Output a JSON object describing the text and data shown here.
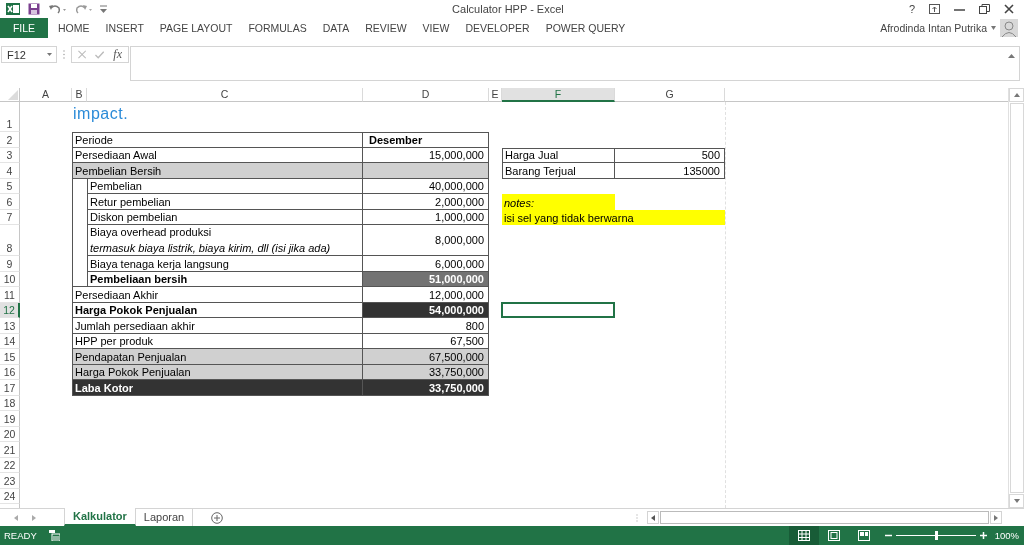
{
  "window": {
    "title": "Calculator HPP - Excel",
    "help": "?"
  },
  "ribbon": {
    "file_tab": "FILE",
    "tabs": [
      "HOME",
      "INSERT",
      "PAGE LAYOUT",
      "FORMULAS",
      "DATA",
      "REVIEW",
      "VIEW",
      "DEVELOPER",
      "POWER QUERY"
    ],
    "user": "Afrodinda Intan Putrika"
  },
  "formula_bar": {
    "name_box": "F12",
    "function_label": "fx"
  },
  "sheet": {
    "columns": [
      {
        "label": "A",
        "selected": false
      },
      {
        "label": "B",
        "selected": false
      },
      {
        "label": "C",
        "selected": false
      },
      {
        "label": "D",
        "selected": false
      },
      {
        "label": "E",
        "selected": false
      },
      {
        "label": "F",
        "selected": true
      },
      {
        "label": "G",
        "selected": false
      }
    ],
    "rows": [
      {
        "label": "1",
        "selected": false
      },
      {
        "label": "2",
        "selected": false
      },
      {
        "label": "3",
        "selected": false
      },
      {
        "label": "4",
        "selected": false
      },
      {
        "label": "5",
        "selected": false
      },
      {
        "label": "6",
        "selected": false
      },
      {
        "label": "7",
        "selected": false
      },
      {
        "label": "8",
        "selected": false
      },
      {
        "label": "9",
        "selected": false
      },
      {
        "label": "10",
        "selected": false
      },
      {
        "label": "11",
        "selected": false
      },
      {
        "label": "12",
        "selected": true
      },
      {
        "label": "13",
        "selected": false
      },
      {
        "label": "14",
        "selected": false
      },
      {
        "label": "15",
        "selected": false
      },
      {
        "label": "16",
        "selected": false
      },
      {
        "label": "17",
        "selected": false
      },
      {
        "label": "18",
        "selected": false
      },
      {
        "label": "19",
        "selected": false
      },
      {
        "label": "20",
        "selected": false
      },
      {
        "label": "21",
        "selected": false
      },
      {
        "label": "22",
        "selected": false
      },
      {
        "label": "23",
        "selected": false
      },
      {
        "label": "24",
        "selected": false
      }
    ],
    "logo": "impact.",
    "main_table": [
      {
        "kind": "heading",
        "indent": false,
        "label": "Periode",
        "value": "Desember"
      },
      {
        "kind": "plain",
        "indent": false,
        "label": "Persediaan Awal",
        "value": "15,000,000"
      },
      {
        "kind": "shaded",
        "indent": false,
        "label": "Pembelian Bersih"
      },
      {
        "kind": "plain",
        "indent": true,
        "label": "Pembelian",
        "value": "40,000,000"
      },
      {
        "kind": "plain",
        "indent": true,
        "label": "Retur pembelian",
        "value": "2,000,000"
      },
      {
        "kind": "plain",
        "indent": true,
        "label": "Diskon pembelian",
        "value": "1,000,000"
      },
      {
        "kind": "plain",
        "indent": true,
        "label": "Biaya overhead produksi",
        "note": "termasuk biaya listrik, biaya kirim, dll (isi jika ada)",
        "value": "8,000,000"
      },
      {
        "kind": "plain",
        "indent": true,
        "label": "Biaya tenaga kerja langsung",
        "value": "6,000,000"
      },
      {
        "kind": "subtotal",
        "indent": true,
        "label": "Pembeliaan bersih",
        "value": "51,000,000"
      },
      {
        "kind": "plain",
        "indent": false,
        "label": "Persediaan Akhir",
        "value": "12,000,000"
      },
      {
        "kind": "total",
        "indent": false,
        "label": "Harga Pokok Penjualan",
        "value": "54,000,000"
      },
      {
        "kind": "plain",
        "indent": false,
        "label": "Jumlah persediaan akhir",
        "value": "800"
      },
      {
        "kind": "plain",
        "indent": false,
        "label": "HPP per produk",
        "value": "67,500"
      },
      {
        "kind": "shaded",
        "indent": false,
        "label": "Pendapatan Penjualan",
        "value": "67,500,000"
      },
      {
        "kind": "shaded",
        "indent": false,
        "label": "Harga Pokok Penjualan",
        "value": "33,750,000"
      },
      {
        "kind": "grand_total",
        "indent": false,
        "label": "Laba Kotor",
        "value": "33,750,000"
      }
    ],
    "side_table": [
      {
        "label": "Harga Jual",
        "value": "500"
      },
      {
        "label": "Barang Terjual",
        "value": "135000"
      }
    ],
    "notes": {
      "title": "notes:",
      "text": "isi sel yang tidak berwarna"
    }
  },
  "sheet_tabs": [
    {
      "label": "Kalkulator",
      "selected": true
    },
    {
      "label": "Laporan",
      "selected": false
    }
  ],
  "status_bar": {
    "mode": "READY",
    "views": [
      {
        "kind": "normal",
        "selected": true
      },
      {
        "kind": "page_layout",
        "selected": false
      },
      {
        "kind": "page_break",
        "selected": false
      }
    ],
    "zoom_slider": {
      "level": 0.5
    },
    "zoom": "100%"
  }
}
